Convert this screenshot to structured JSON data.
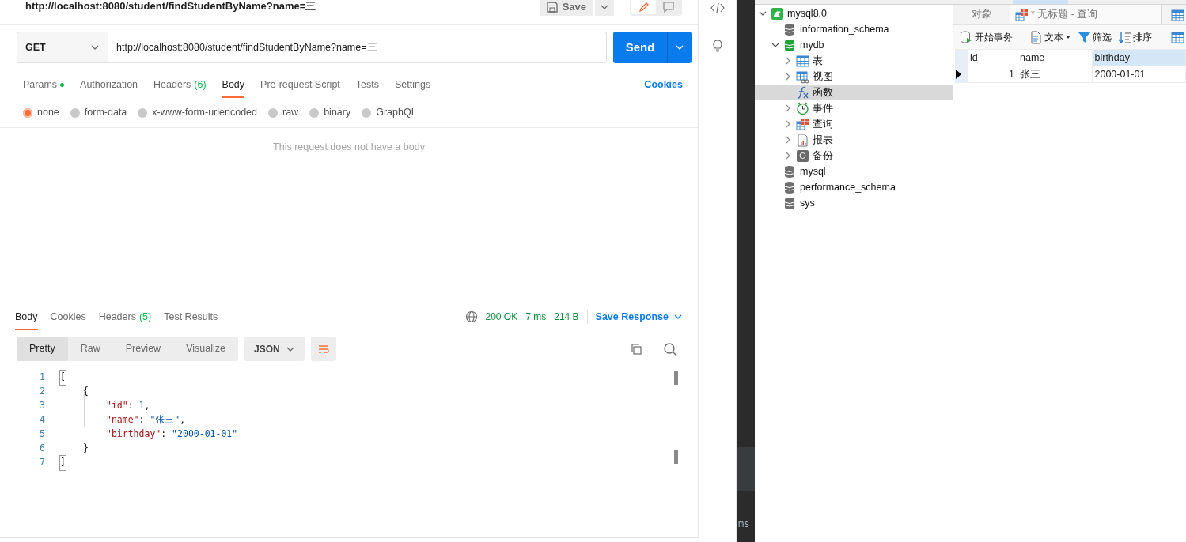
{
  "postman": {
    "title": "http://localhost:8080/student/findStudentByName?name=三",
    "save": "Save",
    "request": {
      "method": "GET",
      "url": "http://localhost:8080/student/findStudentByName?name=三",
      "send": "Send"
    },
    "request_tabs": [
      {
        "label": "Params",
        "dot": true,
        "selected": false
      },
      {
        "label": "Authorization",
        "selected": false
      },
      {
        "label": "Headers",
        "count": "(6)",
        "selected": false
      },
      {
        "label": "Body",
        "selected": true
      },
      {
        "label": "Pre-request Script",
        "selected": false
      },
      {
        "label": "Tests",
        "selected": false
      },
      {
        "label": "Settings",
        "selected": false
      }
    ],
    "cookies_link": "Cookies",
    "body_types": [
      {
        "label": "none",
        "selected": true
      },
      {
        "label": "form-data",
        "selected": false
      },
      {
        "label": "x-www-form-urlencoded",
        "selected": false
      },
      {
        "label": "raw",
        "selected": false
      },
      {
        "label": "binary",
        "selected": false
      },
      {
        "label": "GraphQL",
        "selected": false
      }
    ],
    "empty_body_text": "This request does not have a body",
    "response": {
      "tabs": [
        {
          "label": "Body",
          "selected": true
        },
        {
          "label": "Cookies",
          "selected": false
        },
        {
          "label": "Headers",
          "count": "(5)",
          "selected": false
        },
        {
          "label": "Test Results",
          "selected": false
        }
      ],
      "status": "200 OK",
      "time": "7 ms",
      "size": "214 B",
      "save_response": "Save Response",
      "view_modes": [
        {
          "label": "Pretty",
          "selected": true
        },
        {
          "label": "Raw",
          "selected": false
        },
        {
          "label": "Preview",
          "selected": false
        },
        {
          "label": "Visualize",
          "selected": false
        }
      ],
      "format": "JSON",
      "code_lines": [
        {
          "number": "1",
          "tokens": [
            {
              "text": "[",
              "kind": "bracket"
            }
          ],
          "children": [
            {
              "number": "2",
              "tokens": [
                {
                  "text": "{",
                  "kind": "punct"
                }
              ],
              "children": [
                {
                  "number": "3",
                  "tokens": [
                    {
                      "text": "\"id\"",
                      "kind": "key"
                    },
                    {
                      "text": ": ",
                      "kind": "punct"
                    },
                    {
                      "text": "1",
                      "kind": "number"
                    },
                    {
                      "text": ",",
                      "kind": "punct"
                    }
                  ]
                },
                {
                  "number": "4",
                  "tokens": [
                    {
                      "text": "\"name\"",
                      "kind": "key"
                    },
                    {
                      "text": ": ",
                      "kind": "punct"
                    },
                    {
                      "text": "\"张三\"",
                      "kind": "string"
                    },
                    {
                      "text": ",",
                      "kind": "punct"
                    }
                  ]
                },
                {
                  "number": "5",
                  "tokens": [
                    {
                      "text": "\"birthday\"",
                      "kind": "key"
                    },
                    {
                      "text": ": ",
                      "kind": "punct"
                    },
                    {
                      "text": "\"2000-01-01\"",
                      "kind": "string"
                    }
                  ]
                }
              ]
            },
            {
              "number": "6",
              "tokens": [
                {
                  "text": "}",
                  "kind": "punct"
                }
              ]
            }
          ]
        },
        {
          "number": "7",
          "tokens": [
            {
              "text": "]",
              "kind": "bracket"
            }
          ]
        }
      ]
    }
  },
  "terminal_fragment": "ms",
  "navicat": {
    "tree": [
      {
        "label": "mysql8.0",
        "kind": "connection",
        "expanded": true,
        "selected": false,
        "children": [
          {
            "label": "information_schema",
            "kind": "database",
            "selected": false
          },
          {
            "label": "mydb",
            "kind": "database-open",
            "expanded": true,
            "selected": false,
            "children": [
              {
                "label": "表",
                "kind": "table",
                "expanded": false,
                "selected": false
              },
              {
                "label": "视图",
                "kind": "view",
                "expanded": false,
                "selected": false
              },
              {
                "label": "函数",
                "kind": "function",
                "selected": true
              },
              {
                "label": "事件",
                "kind": "event",
                "expanded": false,
                "selected": false
              },
              {
                "label": "查询",
                "kind": "query",
                "expanded": false,
                "selected": false
              },
              {
                "label": "报表",
                "kind": "report",
                "expanded": false,
                "selected": false
              },
              {
                "label": "备份",
                "kind": "backup",
                "expanded": false,
                "selected": false
              }
            ]
          },
          {
            "label": "mysql",
            "kind": "database",
            "selected": false
          },
          {
            "label": "performance_schema",
            "kind": "database",
            "selected": false
          },
          {
            "label": "sys",
            "kind": "database",
            "selected": false
          }
        ]
      }
    ],
    "tabs": [
      {
        "label": "对象",
        "selected": false
      },
      {
        "label": "* 无标题 - 查询",
        "selected": true
      }
    ],
    "toolbar": [
      {
        "label": "开始事务",
        "kind": "transaction"
      },
      {
        "label": "文本",
        "kind": "text",
        "dropdown": true
      },
      {
        "label": "筛选",
        "kind": "filter"
      },
      {
        "label": "排序",
        "kind": "sort"
      }
    ],
    "grid": {
      "columns": [
        {
          "label": "id",
          "selected": false
        },
        {
          "label": "name",
          "selected": false
        },
        {
          "label": "birthday",
          "selected": true
        }
      ],
      "rows": [
        {
          "selected": true,
          "cells": [
            "1",
            "张三",
            "2000-01-01"
          ]
        }
      ]
    }
  }
}
